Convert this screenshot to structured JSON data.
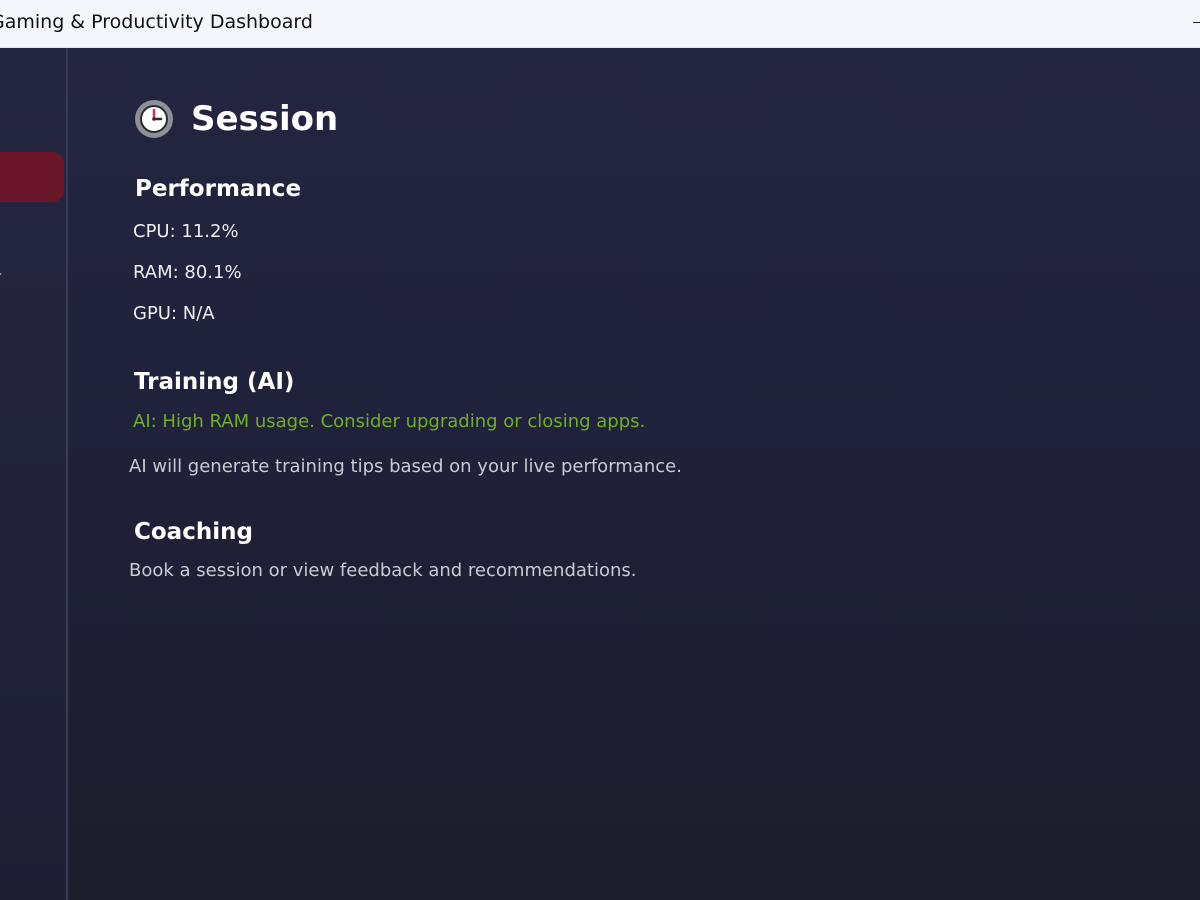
{
  "window": {
    "title": "Gaming & Productivity Dashboard"
  },
  "sidebar": {
    "partial_glyph": "⁄"
  },
  "page": {
    "title": "Session",
    "icon": "clock-icon"
  },
  "performance": {
    "title": "Performance",
    "cpu": "CPU: 11.2%",
    "ram": "RAM: 80.1%",
    "gpu": "GPU: N/A"
  },
  "training": {
    "title": "Training (AI)",
    "ai_tip": "AI: High RAM usage. Consider upgrading or closing apps.",
    "description": "AI will generate training tips based on your live performance."
  },
  "coaching": {
    "title": "Coaching",
    "description": "Book a session or view feedback and recommendations."
  },
  "colors": {
    "accent": "#6a1829",
    "ai_tip": "#6fb020",
    "background": "#20213a"
  }
}
